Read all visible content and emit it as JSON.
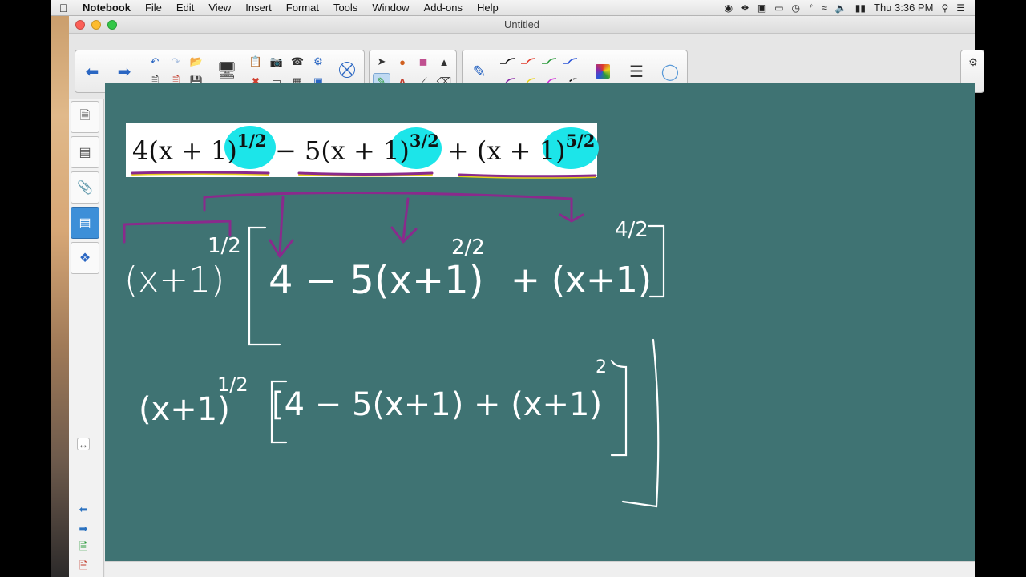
{
  "menubar": {
    "app_name": "Notebook",
    "items": [
      "File",
      "Edit",
      "View",
      "Insert",
      "Format",
      "Tools",
      "Window",
      "Add-ons",
      "Help"
    ],
    "clock": "Thu 3:36 PM"
  },
  "window": {
    "title": "Untitled"
  },
  "toolbar": {
    "nav": [
      "back-arrow-icon",
      "forward-arrow-icon"
    ],
    "pen_colors": [
      "#111111",
      "#e03a2a",
      "#2a9a3a",
      "#2a54d8",
      "#8a2aa8",
      "#e8d21a",
      "#d02ad8",
      "#111111"
    ]
  },
  "canvas": {
    "background": "#3f7373",
    "banner_expression": {
      "t1": "4(x + 1)",
      "e1": "1/2",
      "op1": " − ",
      "t2": "5(x + 1)",
      "e2": "3/2",
      "op2": " + ",
      "t3": "(x + 1)",
      "e3": "5/2"
    },
    "highlight_color": "#1ce5e9",
    "ink_color": "#ffffff",
    "annotation_color": "#8a2a8c"
  },
  "handwriting": {
    "line1_factor": "(x+1)",
    "line1_factor_exp": "1/2",
    "line1_bracket_open": "[",
    "line1_term1": "4 − 5(x+1)",
    "line1_term1_exp": "2/2",
    "line1_term2": "+ (x+1)",
    "line1_term2_exp": "4/2",
    "line1_bracket_close": "]",
    "line2_factor": "(x+1)",
    "line2_factor_exp": "1/2",
    "line2_body": "[4 − 5(x+1) + (x+1)",
    "line2_body_exp": "2",
    "line2_bracket_close": "]"
  }
}
